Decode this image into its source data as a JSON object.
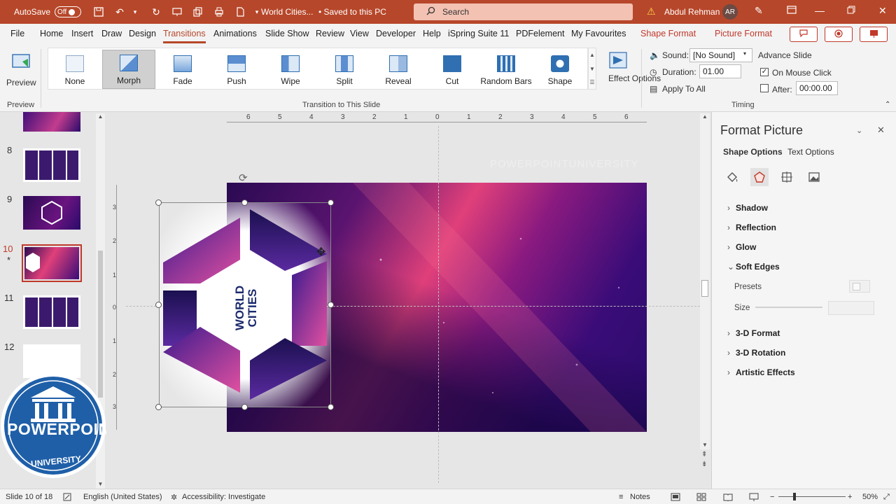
{
  "titlebar": {
    "autosave_label": "AutoSave",
    "autosave_state": "Off",
    "doc_title": "World Cities...",
    "saved_status": "• Saved to this PC",
    "search_placeholder": "Search",
    "user_name": "Abdul Rehman",
    "user_initials": "AR"
  },
  "tabs": [
    "File",
    "Home",
    "Insert",
    "Draw",
    "Design",
    "Transitions",
    "Animations",
    "Slide Show",
    "Review",
    "View",
    "Developer",
    "Help",
    "iSpring Suite 11",
    "PDFelement",
    "My Favourites"
  ],
  "contextual_tabs": [
    "Shape Format",
    "Picture Format"
  ],
  "ribbon": {
    "preview_label": "Preview",
    "preview_group": "Preview",
    "transitions": [
      "None",
      "Morph",
      "Fade",
      "Push",
      "Wipe",
      "Split",
      "Reveal",
      "Cut",
      "Random Bars",
      "Shape"
    ],
    "selected_transition": "Morph",
    "gallery_group": "Transition to This Slide",
    "effect_options": "Effect Options",
    "sound_label": "Sound:",
    "sound_value": "[No Sound]",
    "duration_label": "Duration:",
    "duration_value": "01.00",
    "apply_all": "Apply To All",
    "advance_label": "Advance Slide",
    "on_mouse_click": "On Mouse Click",
    "on_mouse_click_checked": true,
    "after_label": "After:",
    "after_value": "00:00.00",
    "after_checked": false,
    "timing_group": "Timing"
  },
  "thumbnails": {
    "numbers": [
      "8",
      "9",
      "10",
      "11",
      "12"
    ],
    "active": "10",
    "star": "*"
  },
  "slide": {
    "title_line1": "WORLD",
    "title_line2": "CITIES",
    "watermark": "POWERPOINTUNIVERSITY"
  },
  "ruler": {
    "h_labels": [
      "6",
      "5",
      "4",
      "3",
      "2",
      "1",
      "0",
      "1",
      "2",
      "3",
      "4",
      "5",
      "6"
    ],
    "v_labels": [
      "3",
      "2",
      "1",
      "0",
      "1",
      "2",
      "3"
    ]
  },
  "format_pane": {
    "title": "Format Picture",
    "tab_shape": "Shape Options",
    "tab_text": "Text Options",
    "sections": [
      "Shadow",
      "Reflection",
      "Glow",
      "Soft Edges",
      "3-D Format",
      "3-D Rotation",
      "Artistic Effects"
    ],
    "expanded_section": "Soft Edges",
    "presets_label": "Presets",
    "size_label": "Size"
  },
  "status": {
    "slide_counter": "Slide 10 of 18",
    "language": "English (United States)",
    "accessibility": "Accessibility: Investigate",
    "notes": "Notes",
    "zoom": "50%"
  },
  "logo": {
    "line1": "POWERPOINT",
    "line2": "UNIVERSITY"
  },
  "colors": {
    "brand": "#b7472a",
    "accent_red": "#c0392b",
    "logo_blue": "#1f5fa8"
  }
}
